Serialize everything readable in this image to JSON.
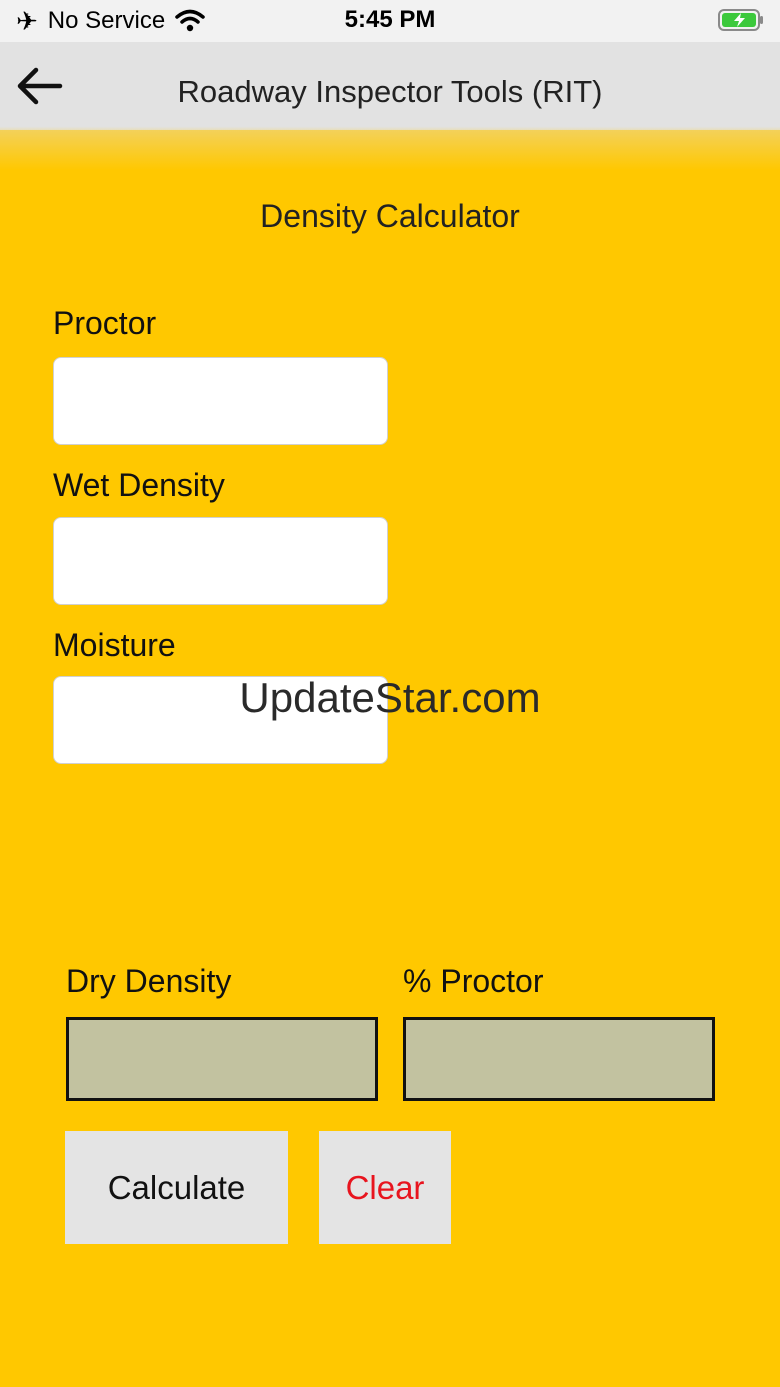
{
  "status_bar": {
    "carrier": "No Service",
    "time": "5:45 PM",
    "icons": [
      "airplane-icon",
      "wifi-icon",
      "battery-charging-icon"
    ]
  },
  "nav": {
    "title": "Roadway Inspector Tools (RIT)",
    "back_icon": "back-arrow-icon"
  },
  "page": {
    "title": "Density Calculator"
  },
  "form": {
    "proctor": {
      "label": "Proctor",
      "value": "",
      "placeholder": ""
    },
    "wet_density": {
      "label": "Wet Density",
      "value": "",
      "placeholder": ""
    },
    "moisture": {
      "label": "Moisture",
      "value": "",
      "placeholder": ""
    }
  },
  "results": {
    "dry_density": {
      "label": "Dry Density",
      "value": ""
    },
    "percent_proctor": {
      "label": "% Proctor",
      "value": ""
    }
  },
  "buttons": {
    "calculate_label": "Calculate",
    "clear_label": "Clear"
  },
  "watermark": "UpdateStar.com",
  "colors": {
    "background": "#FFC800",
    "nav_background": "#E2E2E2",
    "result_box": "#C2C2A0",
    "button_background": "#E4E4E4",
    "clear_text": "#E8141E",
    "battery_green": "#3CC93C"
  }
}
